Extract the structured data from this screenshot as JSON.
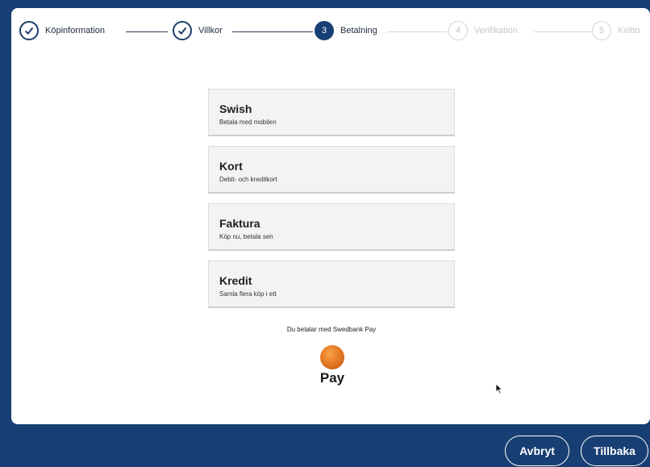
{
  "stepper": {
    "steps": [
      {
        "number": "",
        "label": "Köpinformation",
        "state": "done"
      },
      {
        "number": "",
        "label": "Villkor",
        "state": "done"
      },
      {
        "number": "3",
        "label": "Betalning",
        "state": "current"
      },
      {
        "number": "4",
        "label": "Verifikation",
        "state": "pending"
      },
      {
        "number": "5",
        "label": "Kvitto",
        "state": "pending"
      }
    ]
  },
  "options": [
    {
      "title": "Swish",
      "subtitle": "Betala med mobilen"
    },
    {
      "title": "Kort",
      "subtitle": "Debit- och kreditkort"
    },
    {
      "title": "Faktura",
      "subtitle": "Köp nu, betala sen"
    },
    {
      "title": "Kredit",
      "subtitle": "Samla flera köp i ett"
    }
  ],
  "provider": {
    "info": "Du betalar med Swedbank Pay",
    "logo_text": "Pay"
  },
  "footer": {
    "cancel_label": "Avbryt",
    "back_label": "Tillbaka"
  },
  "colors": {
    "brand": "#183f73",
    "logo_orange": "#e67a24"
  }
}
